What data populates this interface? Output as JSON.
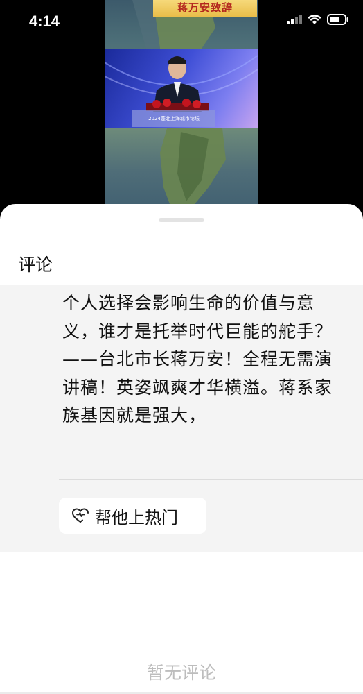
{
  "status_bar": {
    "time": "4:14"
  },
  "video": {
    "banner": "蒋万安致辞",
    "podium_text": "2024蓬北上海城市论坛"
  },
  "comments_sheet": {
    "title": "评论",
    "description": "个人选择会影响生命的价值与意义，谁才是托举时代巨能的舵手？——台北市长蒋万安！全程无需演讲稿！英姿飒爽才华横溢。蒋系家族基因就是强大，",
    "boost_button": {
      "label": "帮他上热门",
      "icon": "heart-plus-icon"
    },
    "empty_state": "暂无评论"
  }
}
